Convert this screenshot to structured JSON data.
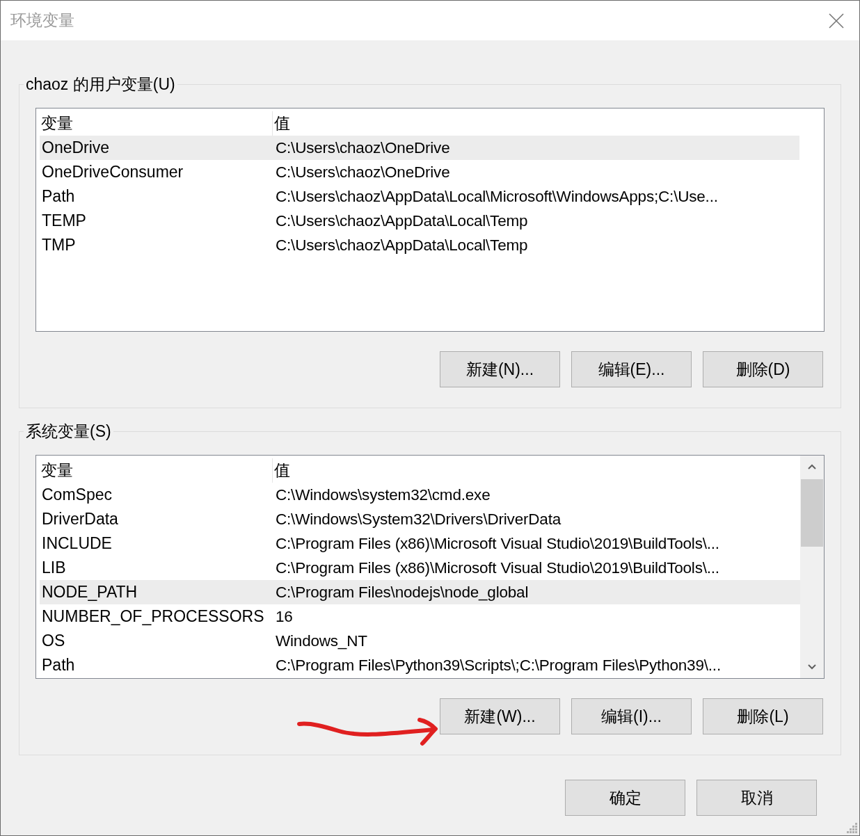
{
  "window": {
    "title": "环境变量"
  },
  "user_variables": {
    "title": "chaoz 的用户变量(U)",
    "columns": [
      "变量",
      "值"
    ],
    "rows": [
      {
        "name": "OneDrive",
        "value": "C:\\Users\\chaoz\\OneDrive",
        "selected": true
      },
      {
        "name": "OneDriveConsumer",
        "value": "C:\\Users\\chaoz\\OneDrive",
        "selected": false
      },
      {
        "name": "Path",
        "value": "C:\\Users\\chaoz\\AppData\\Local\\Microsoft\\WindowsApps;C:\\Use...",
        "selected": false
      },
      {
        "name": "TEMP",
        "value": "C:\\Users\\chaoz\\AppData\\Local\\Temp",
        "selected": false
      },
      {
        "name": "TMP",
        "value": "C:\\Users\\chaoz\\AppData\\Local\\Temp",
        "selected": false
      }
    ],
    "buttons": [
      "新建(N)...",
      "编辑(E)...",
      "删除(D)"
    ]
  },
  "system_variables": {
    "title": "系统变量(S)",
    "columns": [
      "变量",
      "值"
    ],
    "rows": [
      {
        "name": "ComSpec",
        "value": "C:\\Windows\\system32\\cmd.exe",
        "selected": false
      },
      {
        "name": "DriverData",
        "value": "C:\\Windows\\System32\\Drivers\\DriverData",
        "selected": false
      },
      {
        "name": "INCLUDE",
        "value": "C:\\Program Files (x86)\\Microsoft Visual Studio\\2019\\BuildTools\\...",
        "selected": false
      },
      {
        "name": "LIB",
        "value": "C:\\Program Files (x86)\\Microsoft Visual Studio\\2019\\BuildTools\\...",
        "selected": false
      },
      {
        "name": "NODE_PATH",
        "value": "C:\\Program Files\\nodejs\\node_global",
        "selected": true
      },
      {
        "name": "NUMBER_OF_PROCESSORS",
        "value": "16",
        "selected": false
      },
      {
        "name": "OS",
        "value": "Windows_NT",
        "selected": false
      },
      {
        "name": "Path",
        "value": "C:\\Program Files\\Python39\\Scripts\\;C:\\Program Files\\Python39\\...",
        "selected": false
      }
    ],
    "buttons": [
      "新建(W)...",
      "编辑(I)...",
      "删除(L)"
    ]
  },
  "dialog_buttons": [
    "确定",
    "取消"
  ]
}
